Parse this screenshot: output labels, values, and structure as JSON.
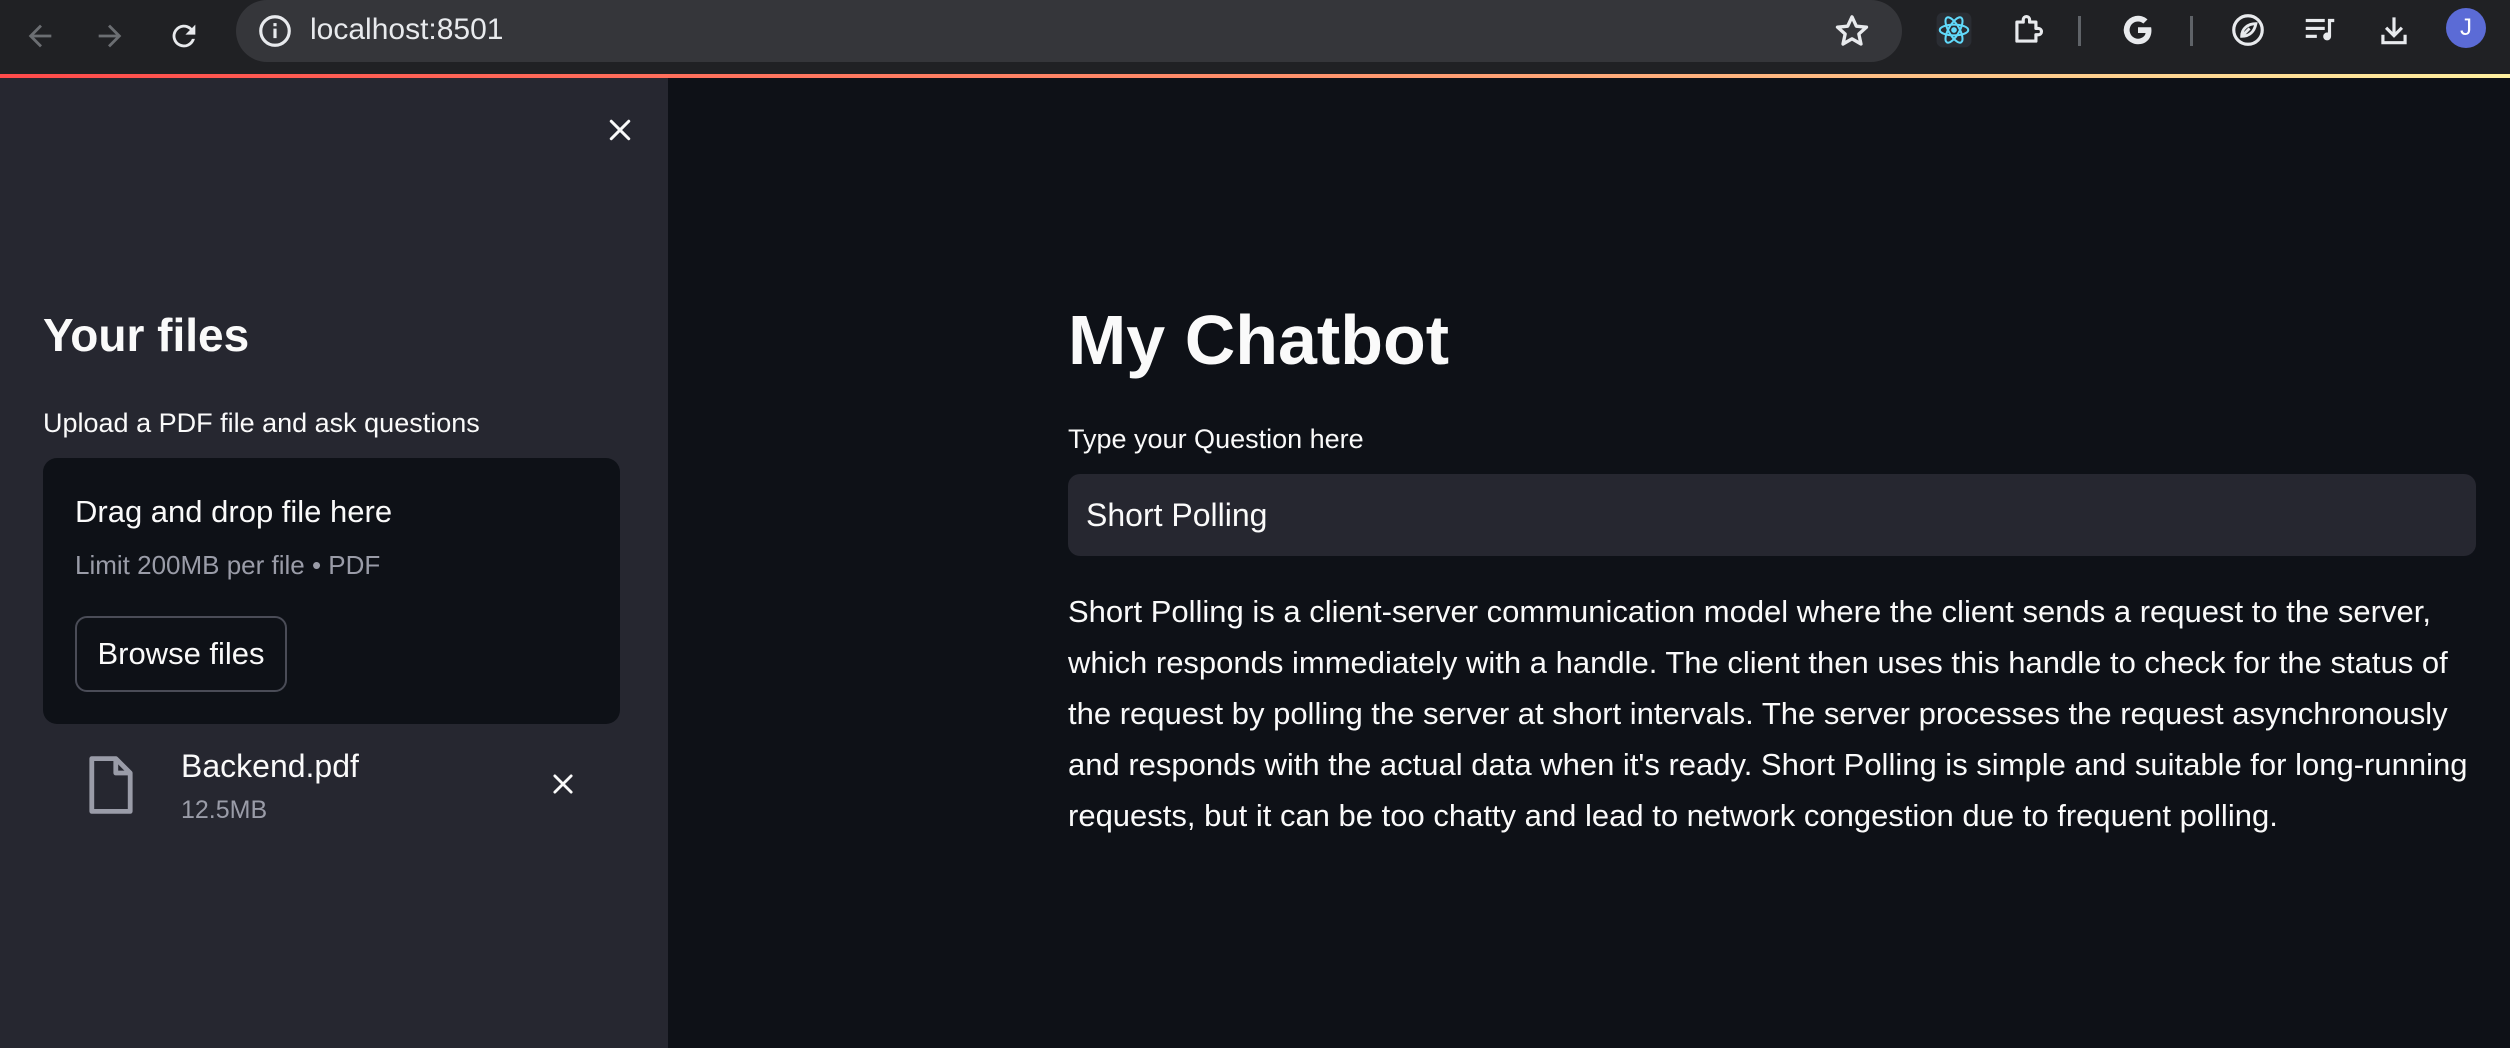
{
  "browser": {
    "url": "localhost:8501",
    "avatar_letter": "J",
    "accent_colors": {
      "avatar": "#5b6bd6",
      "progress_gradient": [
        "#ff4b4b",
        "#ff8f6b",
        "#fff0a0"
      ]
    },
    "icons": [
      "back-arrow-icon",
      "forward-arrow-icon",
      "reload-icon",
      "site-info-icon",
      "bookmark-star-icon",
      "react-devtools-icon",
      "extensions-puzzle-icon",
      "google-g-icon",
      "leaf-extension-icon",
      "media-queue-icon",
      "download-icon"
    ]
  },
  "sidebar": {
    "title": "Your files",
    "upload_label": "Upload a PDF file and ask questions",
    "dropzone": {
      "title": "Drag and drop file here",
      "limit": "Limit 200MB per file • PDF",
      "browse_label": "Browse files"
    },
    "file": {
      "name": "Backend.pdf",
      "size": "12.5MB"
    }
  },
  "main": {
    "title": "My Chatbot",
    "question_label": "Type your Question here",
    "question_value": "Short Polling",
    "answer": "Short Polling is a client-server communication model where the client sends a request to the server, which responds immediately with a handle. The client then uses this handle to check for the status of the request by polling the server at short intervals. The server processes the request asynchronously and responds with the actual data when it's ready. Short Polling is simple and suitable for long-running requests, but it can be too chatty and lead to network congestion due to frequent polling."
  },
  "colors": {
    "main_background": "#0e1117",
    "sidebar_background": "#262730",
    "text": "#fafafa",
    "muted_text": "#9a9ca8"
  }
}
